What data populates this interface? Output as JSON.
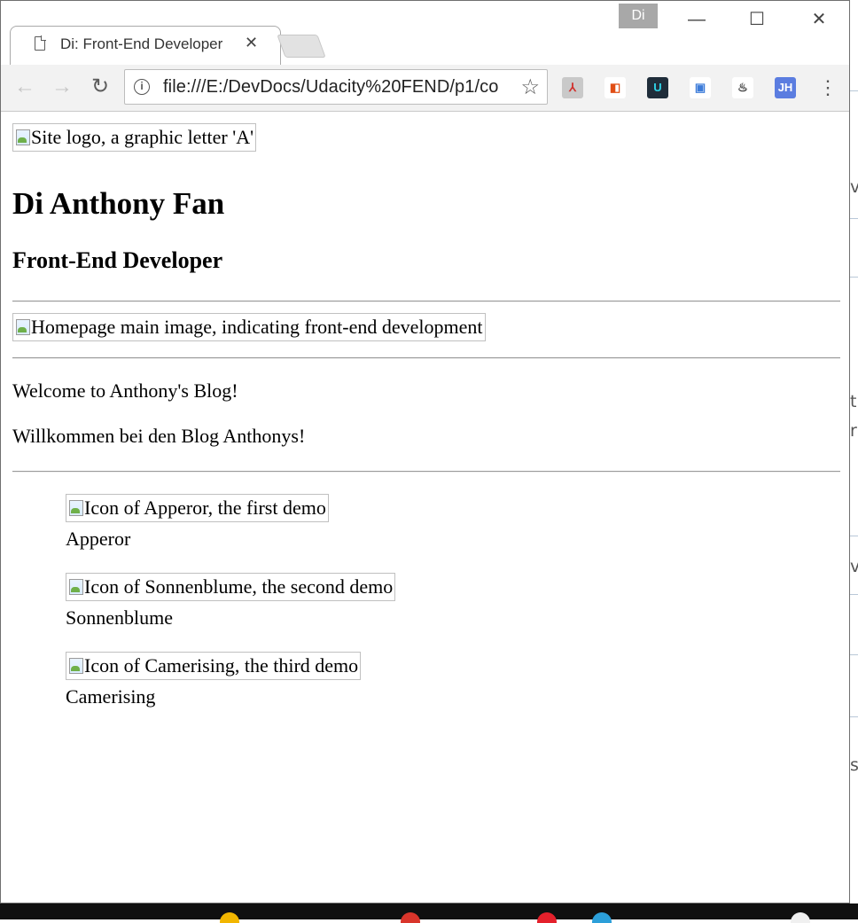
{
  "browser": {
    "tab_title": "Di: Front-End Developer",
    "tab_close": "✕",
    "profile_name": "Di",
    "url": "file:///E:/DevDocs/Udacity%20FEND/p1/co",
    "window_controls": {
      "minimize": "—",
      "maximize": "☐",
      "close": "✕"
    },
    "nav": {
      "back": "←",
      "forward": "→",
      "reload": "↻"
    },
    "star": "☆",
    "menu": "⋮",
    "extensions": [
      {
        "name": "acrobat-extension-icon",
        "glyph": "⅄",
        "bg": "#c9c9c9",
        "fg": "#d0312d"
      },
      {
        "name": "office-extension-icon",
        "glyph": "◧",
        "bg": "#ffffff",
        "fg": "#e04e14"
      },
      {
        "name": "udacity-extension-icon",
        "glyph": "U",
        "bg": "#1f2d3a",
        "fg": "#2fd3e7"
      },
      {
        "name": "screenshot-extension-icon",
        "glyph": "▣",
        "bg": "#ffffff",
        "fg": "#3d7cd9"
      },
      {
        "name": "flame-extension-icon",
        "glyph": "♨",
        "bg": "#ffffff",
        "fg": "#333333"
      },
      {
        "name": "jh-extension-icon",
        "glyph": "JH",
        "bg": "#5b7de0",
        "fg": "#ffffff"
      }
    ]
  },
  "page": {
    "logo_alt": "Site logo, a graphic letter 'A'",
    "name": "Di Anthony Fan",
    "role": "Front-End Developer",
    "main_image_alt": "Homepage main image, indicating front-end development",
    "welcome_en": "Welcome to Anthony's Blog!",
    "welcome_de": "Willkommen bei den Blog Anthonys!",
    "demos": [
      {
        "alt": "Icon of Apperor, the first demo",
        "label": "Apperor"
      },
      {
        "alt": "Icon of Sonnenblume, the second demo",
        "label": "Sonnenblume"
      },
      {
        "alt": "Icon of Camerising, the third demo",
        "label": "Camerising"
      }
    ]
  },
  "background_window": {
    "fragments": [
      "v",
      "t",
      "r",
      "v",
      "s:"
    ]
  }
}
